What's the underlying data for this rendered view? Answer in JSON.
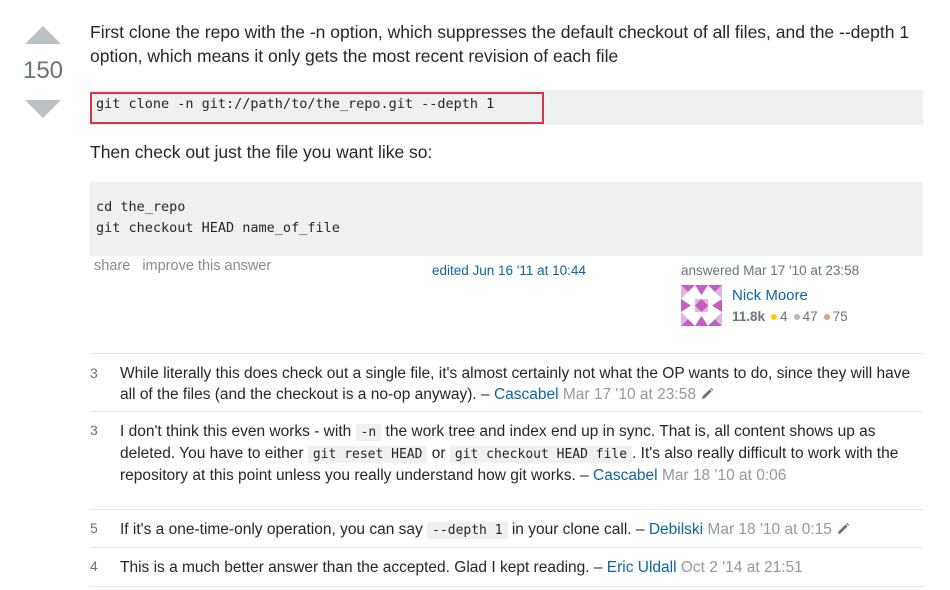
{
  "vote": {
    "count": "150"
  },
  "answer": {
    "para1": "First clone the repo with the -n option, which suppresses the default checkout of all files, and the --depth 1 option, which means it only gets the most recent revision of each file",
    "code1": "git clone -n git://path/to/the_repo.git --depth 1",
    "para2": "Then check out just the file you want like so:",
    "code2_line1": "cd the_repo",
    "code2_line2": "git checkout HEAD name_of_file"
  },
  "post_menu": {
    "share": "share",
    "improve": "improve this answer"
  },
  "edited": "edited Jun 16 '11 at 10:44",
  "answered": "answered Mar 17 '10 at 23:58",
  "user": {
    "name": "Nick Moore",
    "reputation": "11.8k",
    "gold": "4",
    "silver": "47",
    "bronze": "75",
    "gold_color": "#ffcc01",
    "silver_color": "#b4b8bc",
    "bronze_color": "#d1a684"
  },
  "comments": [
    {
      "score": "3",
      "text_a": "While literally this does check out a single file, it's almost certainly not what the OP wants to do, since they will have all of the files (and the checkout is a no-op anyway). – ",
      "user": "Cascabel",
      "date": "Mar 17 '10 at 23:58"
    },
    {
      "score": "3",
      "text_a": "I don't think this even works - with ",
      "code_a": "-n",
      "text_b": " the work tree and index end up in sync. That is, all content shows up as deleted. You have to either ",
      "code_b": "git reset HEAD",
      "text_c": " or ",
      "code_c": "git checkout HEAD file",
      "text_d": ". It's also really difficult to work with the repository at this point unless you really understand how git works. – ",
      "user": "Cascabel",
      "date": "Mar 18 '10 at 0:06"
    },
    {
      "score": "5",
      "text_a": "If it's a one-time-only operation, you can say ",
      "code_a": "--depth 1",
      "text_b": " in your clone call. – ",
      "user": "Debilski",
      "date": "Mar 18 '10 at 0:15"
    },
    {
      "score": "4",
      "text_a": "This is a much better answer than the accepted. Glad I kept reading. – ",
      "user": "Eric Uldall",
      "date": "Oct 2 '14 at 21:51"
    }
  ]
}
